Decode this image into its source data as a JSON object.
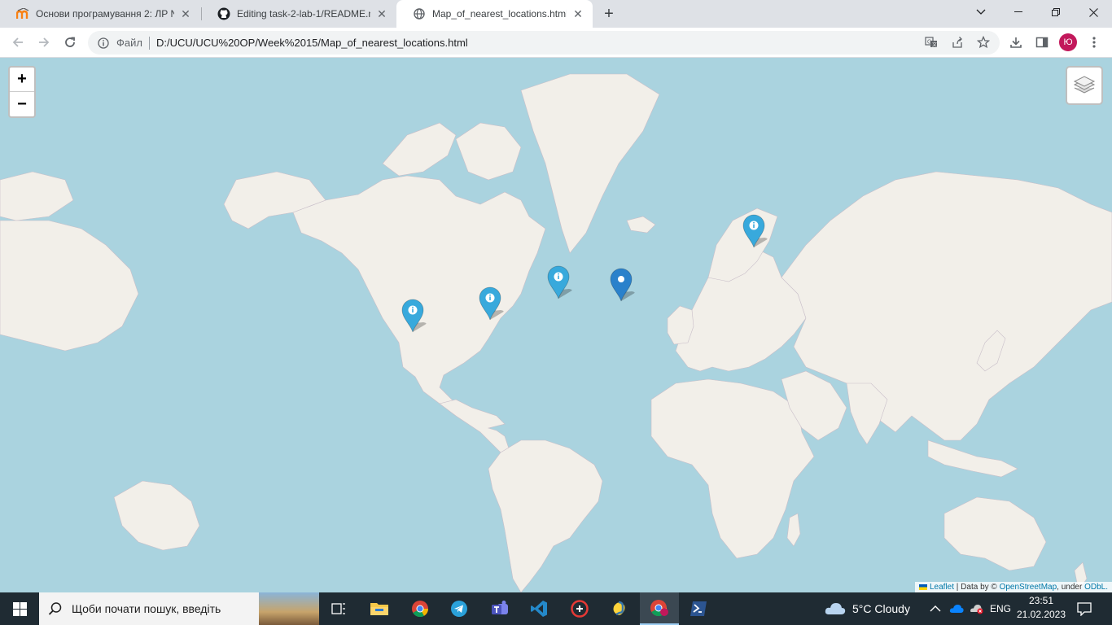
{
  "browser": {
    "tabs": [
      {
        "title": "Основи програмування 2: ЛР N",
        "icon": "moodle-icon"
      },
      {
        "title": "Editing task-2-lab-1/README.mc",
        "icon": "github-icon"
      },
      {
        "title": "Map_of_nearest_locations.html",
        "icon": "globe-icon",
        "active": true
      }
    ],
    "address": {
      "scheme_label": "Файл",
      "url": "D:/UCU/UCU%20OP/Week%2015/Map_of_nearest_locations.html"
    },
    "profile_initial": "Ю"
  },
  "map": {
    "zoom_in_label": "+",
    "zoom_out_label": "−",
    "markers": [
      {
        "type": "info",
        "lat": 53.5,
        "lon": -8.0
      },
      {
        "type": "info",
        "lat": 34.0,
        "lon": -118.3
      },
      {
        "type": "info",
        "lat": 37.2,
        "lon": -93.3
      },
      {
        "type": "info",
        "lat": 42.4,
        "lon": -71.1
      },
      {
        "type": "plain",
        "lat": 41.8,
        "lon": -51.0
      }
    ],
    "attribution": {
      "leaflet": "Leaflet",
      "sep": " | Data by © ",
      "osm": "OpenStreetMap",
      "under": ", under ",
      "license": "ODbL."
    }
  },
  "taskbar": {
    "search_placeholder": "Щоби почати пошук, введіть",
    "weather": "5°C  Cloudy",
    "language": "ENG",
    "time": "23:51",
    "date": "21.02.2023",
    "apps": [
      "task-view-icon",
      "file-explorer-icon",
      "chrome-icon",
      "telegram-icon",
      "teams-icon",
      "vscode-icon",
      "gaming-app-icon",
      "python-idle-icon",
      "chrome-profile-icon",
      "powershell-icon"
    ]
  },
  "colors": {
    "water": "#aad3df",
    "land": "#f2efe9",
    "marker_info": "#38a9dc",
    "marker_plain": "#2a81cb"
  }
}
